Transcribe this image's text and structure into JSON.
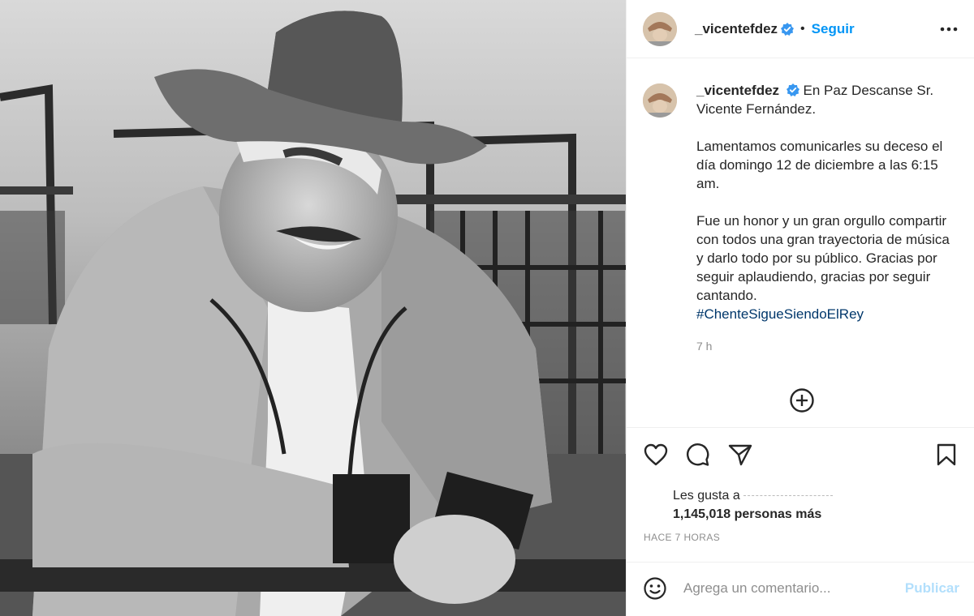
{
  "post": {
    "username": "_vicentefdez",
    "follow_label": "Seguir",
    "dot": "•",
    "photo_alt": "Black and white portrait of a smiling man in a cowboy hat and suede jacket leaning on a rail"
  },
  "caption": {
    "username": "_vicentefdez",
    "line1": "En Paz Descanse Sr. Vicente Fernández.",
    "paragraph2": "Lamentamos comunicarles su deceso el día domingo 12 de diciembre a las 6:15 am.",
    "paragraph3": "Fue un honor y un gran orgullo compartir con todos una gran trayectoria de música y darlo todo por su público. Gracias por seguir aplaudiendo, gracias por seguir cantando.",
    "hashtag": "#ChenteSigueSiendoElRey",
    "relative_time": "7 h"
  },
  "likes": {
    "prefix": "Les gusta a",
    "count_text": "1,145,018 personas más"
  },
  "posted_time": "HACE 7 HORAS",
  "comment": {
    "placeholder": "Agrega un comentario...",
    "publish_label": "Publicar"
  },
  "icons": {
    "verified": "verified-badge-icon",
    "more": "more-options-icon",
    "load_more": "plus-circle-icon",
    "like": "heart-icon",
    "comment": "comment-bubble-icon",
    "share": "paper-plane-icon",
    "save": "bookmark-icon",
    "emoji": "smiley-icon"
  },
  "colors": {
    "link_blue": "#0095f6",
    "hashtag": "#00376b",
    "muted": "#8e8e8e",
    "publish_disabled": "#b2dffc"
  }
}
